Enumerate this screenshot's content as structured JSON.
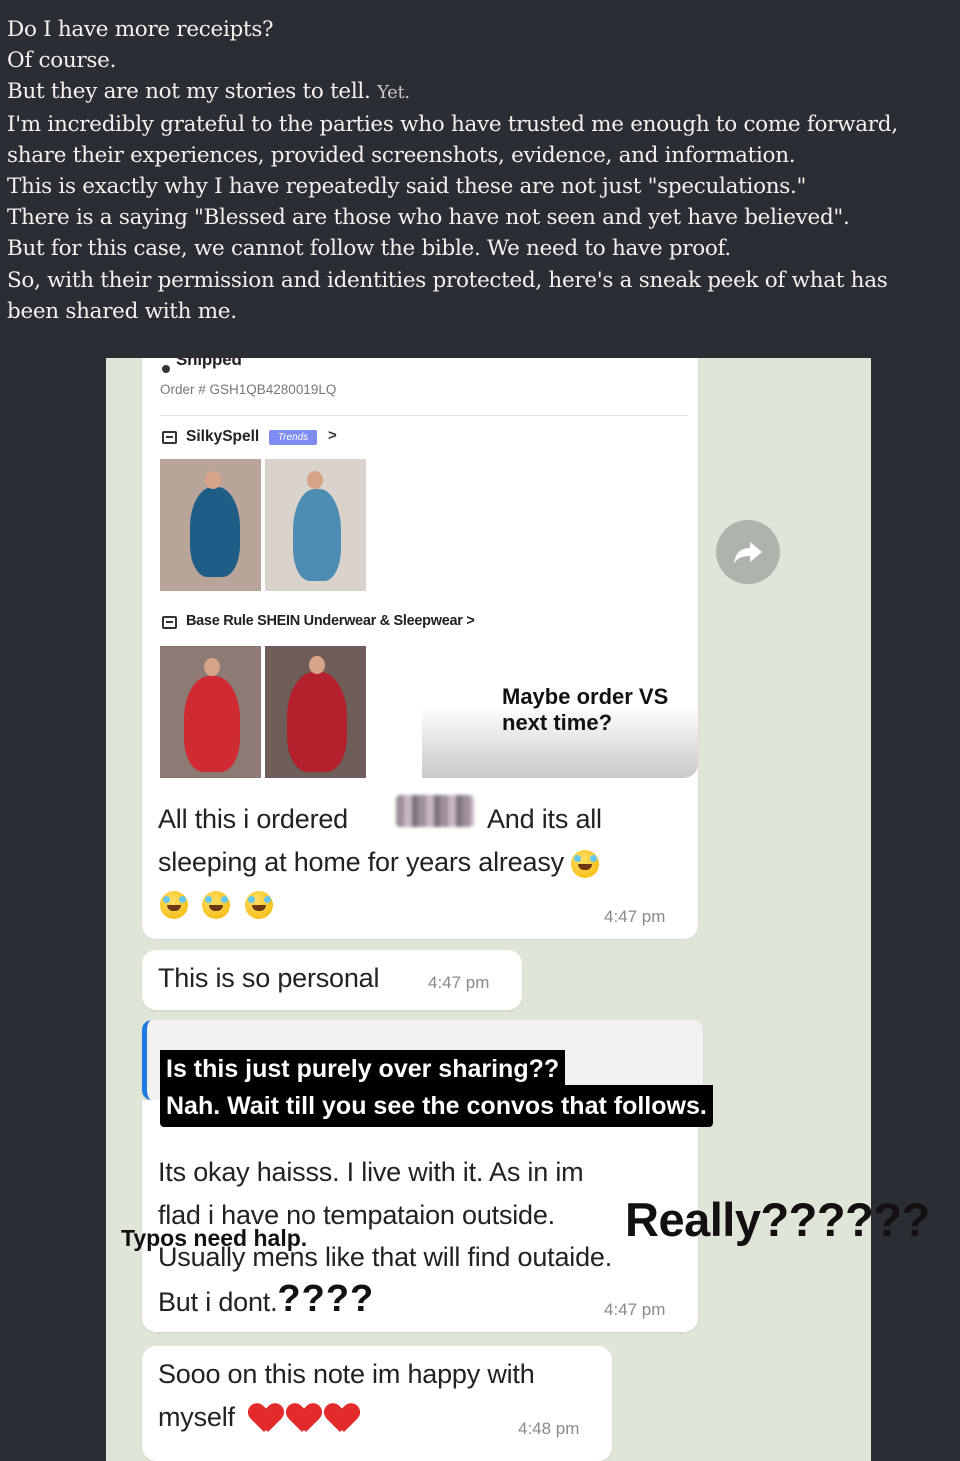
{
  "intro": {
    "lines": [
      "Do I have more receipts?",
      "Of course.",
      "But they are not my stories to tell.",
      "I'm incredibly grateful to the parties who have trusted me enough to come forward,",
      "share their experiences, provided screenshots, evidence, and information.",
      "This is exactly why I have repeatedly said these are not just \"speculations.\"",
      "There is a saying \"Blessed are those who have not seen and yet have believed\".",
      "But for this case, we cannot follow the bible. We need to have proof.",
      "So, with their permission and identities protected, here's a sneak peek of what has",
      "been shared with me."
    ],
    "yet": "Yet."
  },
  "order": {
    "status": "Shipped",
    "order_number": "Order # GSH1QB4280019LQ",
    "store1": "SilkySpell",
    "store1_badge": "Trends",
    "store1_chevron": ">",
    "store2": "Base Rule SHEIN Underwear & Sleepwear >"
  },
  "overlays": {
    "caption_vs": "Maybe order VS next time?",
    "over_sharing_1": "Is this just purely over sharing??",
    "over_sharing_2": "Nah. Wait till you see the convos that follows.",
    "really": "Really??????",
    "typos": "Typos need halp.",
    "question_marks": "????"
  },
  "messages": [
    {
      "line1": "All this i ordered",
      "line1b": "And its all",
      "line2": "sleeping at home for years alreasy",
      "time": "4:47 pm"
    },
    {
      "text": "This is so personal",
      "time": "4:47 pm"
    },
    {
      "line1": "Its okay haisss. I live with it. As in im",
      "line2": "flad i have no tempataion outside.",
      "line3": "Usually mens like that will find outaide.",
      "line4": "But i dont.",
      "time": "4:47 pm"
    },
    {
      "line1": "Sooo on this note im happy with",
      "line2": "myself",
      "time": "4:48 pm"
    }
  ],
  "icons": {
    "forward": "forward-arrow-icon",
    "store": "store-icon",
    "emoji_laugh": "rolling-laughing-emoji",
    "heart": "red-heart-emoji"
  }
}
